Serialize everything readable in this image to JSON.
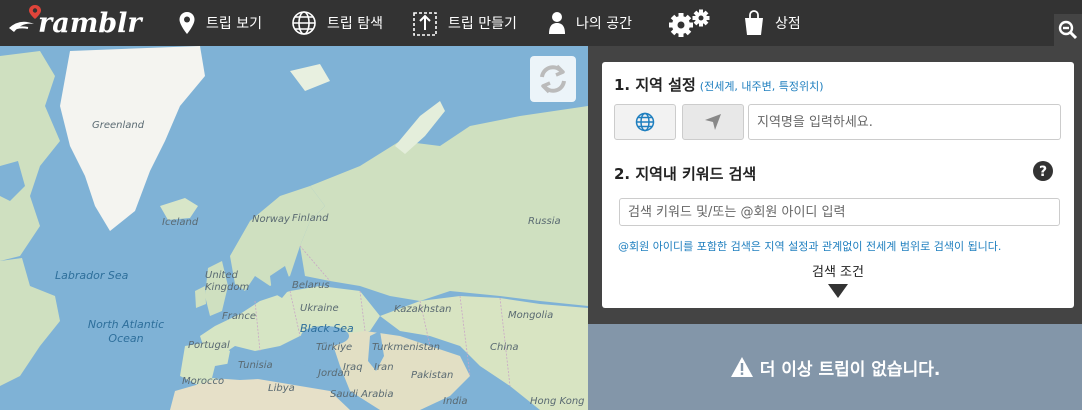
{
  "brand": {
    "name": "ramblr"
  },
  "nav": [
    {
      "id": "view",
      "label": "트립 보기",
      "icon": "map-pin-icon"
    },
    {
      "id": "explore",
      "label": "트립 탐색",
      "icon": "globe-icon"
    },
    {
      "id": "create",
      "label": "트립 만들기",
      "icon": "upload-icon"
    },
    {
      "id": "mine",
      "label": "나의 공간",
      "icon": "user-icon"
    },
    {
      "id": "settings",
      "label": "",
      "icon": "gears-icon"
    },
    {
      "id": "store",
      "label": "상점",
      "icon": "shopping-bag-icon"
    }
  ],
  "map": {
    "labels": {
      "greenland": "Greenland",
      "iceland": "Iceland",
      "norway": "Norway",
      "finland": "Finland",
      "russia": "Russia",
      "labrador_sea": "Labrador Sea",
      "united_kingdom": "United Kingdom",
      "belarus": "Belarus",
      "france": "France",
      "ukraine": "Ukraine",
      "kazakhstan": "Kazakhstan",
      "mongolia": "Mongolia",
      "north_atlantic_ocean": "North Atlantic Ocean",
      "portugal": "Portugal",
      "black_sea": "Black Sea",
      "turkiye": "Türkiye",
      "turkmenistan": "Turkmenistan",
      "china": "China",
      "morocco": "Morocco",
      "tunisia": "Tunisia",
      "iraq": "Iraq",
      "iran": "Iran",
      "libya": "Libya",
      "jordan": "Jordan",
      "pakistan": "Pakistan",
      "saudi_arabia": "Saudi Arabia",
      "india": "India",
      "hong_kong": "Hong Kong"
    }
  },
  "search": {
    "step1_title": "1. 지역 설정",
    "step1_hint": "(전세계, 내주변, 특정위치)",
    "region_placeholder": "지역명을 입력하세요.",
    "step2_title": "2. 지역내 키워드 검색",
    "keyword_placeholder": "검색 키워드 및/또는 @회원 아이디 입력",
    "notice": "@회원 아이디를 포함한 검색은 지역 설정과 관계없이 전세계 범위로 검색이 됩니다.",
    "conditions_label": "검색 조건"
  },
  "results": {
    "empty_message": "더 이상 트립이 없습니다."
  },
  "colors": {
    "topbar": "#333333",
    "panel": "#444444",
    "accent": "#1f7fbf",
    "empty_bg": "#8396a9",
    "ocean": "#7fb2d6",
    "land": "#cfe0c0"
  }
}
